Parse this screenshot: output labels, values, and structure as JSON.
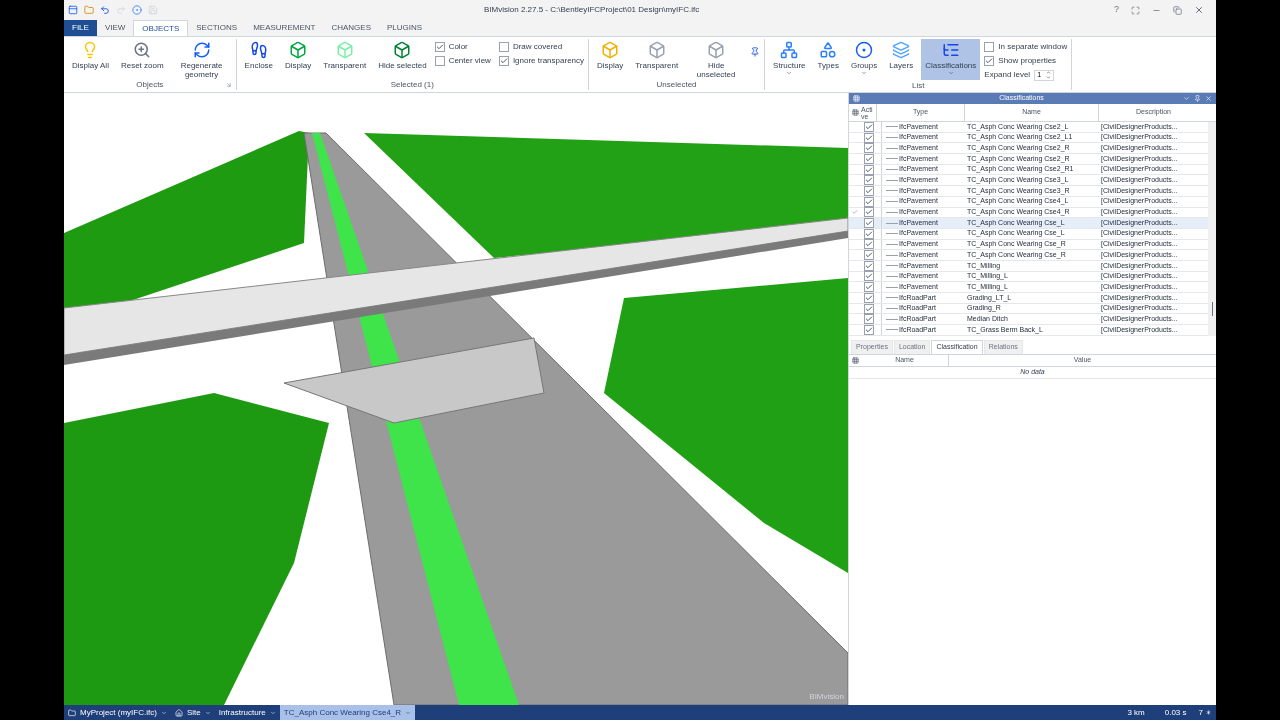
{
  "window": {
    "title": "BIMvision 2.27.5 - C:\\BentleyIFCProject\\01 Design\\myIFC.ifc",
    "help": "?"
  },
  "tabs": [
    {
      "label": "FILE",
      "kind": "file",
      "selected": false
    },
    {
      "label": "VIEW",
      "kind": "tab",
      "selected": false
    },
    {
      "label": "OBJECTS",
      "kind": "tab",
      "selected": true
    },
    {
      "label": "SECTIONS",
      "kind": "tab",
      "selected": false
    },
    {
      "label": "MEASUREMENT",
      "kind": "tab",
      "selected": false
    },
    {
      "label": "CHANGES",
      "kind": "tab",
      "selected": false
    },
    {
      "label": "PLUGINS",
      "kind": "tab",
      "selected": false
    }
  ],
  "ribbon": {
    "groups": [
      {
        "label": "Objects",
        "launcher": true,
        "buttons": [
          {
            "label": "Display All",
            "selected": false,
            "dropdown": false
          },
          {
            "label": "Reset zoom",
            "selected": false,
            "dropdown": false
          },
          {
            "label": "Regenerate geometry",
            "selected": false,
            "dropdown": false
          }
        ]
      },
      {
        "label": "Selected (1)",
        "launcher": false,
        "buttons": [
          {
            "label": "Enclose",
            "selected": false,
            "dropdown": false
          },
          {
            "label": "Display",
            "selected": false,
            "dropdown": false
          },
          {
            "label": "Transparent",
            "selected": false,
            "dropdown": false
          },
          {
            "label": "Hide selected",
            "selected": false,
            "dropdown": false
          }
        ],
        "options": [
          {
            "label": "Color",
            "checked": true
          },
          {
            "label": "Center view",
            "checked": false
          },
          {
            "label": "Draw covered",
            "checked": false
          },
          {
            "label": "Ignore transparency",
            "checked": true
          }
        ]
      },
      {
        "label": "Unselected",
        "launcher": false,
        "buttons": [
          {
            "label": "Display",
            "selected": false,
            "dropdown": false
          },
          {
            "label": "Transparent",
            "selected": false,
            "dropdown": false
          },
          {
            "label": "Hide unselected",
            "selected": false,
            "dropdown": false
          }
        ]
      },
      {
        "label": "List",
        "launcher": false,
        "buttons": [
          {
            "label": "Structure",
            "selected": false,
            "dropdown": true
          },
          {
            "label": "Types",
            "selected": false,
            "dropdown": false
          },
          {
            "label": "Groups",
            "selected": false,
            "dropdown": true
          },
          {
            "label": "Layers",
            "selected": false,
            "dropdown": false
          },
          {
            "label": "Classifications",
            "selected": true,
            "dropdown": true
          }
        ],
        "options": [
          {
            "label": "In separate window",
            "checked": false
          },
          {
            "label": "Show properties",
            "checked": true
          }
        ],
        "spinner": {
          "label": "Expand level",
          "value": "1"
        }
      }
    ]
  },
  "viewport": {
    "logo": "BIMvision"
  },
  "classifications": {
    "title": "Classifications",
    "columns": [
      "Active",
      "Type",
      "Name",
      "Description"
    ],
    "rows": [
      {
        "marked": false,
        "active": true,
        "selected": false,
        "type": "IfcPavement",
        "name": "TC_Asph Conc Wearing Cse2_L",
        "description": "[CivilDesignerProducts..."
      },
      {
        "marked": false,
        "active": true,
        "selected": false,
        "type": "IfcPavement",
        "name": "TC_Asph Conc Wearing Cse2_L1",
        "description": "[CivilDesignerProducts..."
      },
      {
        "marked": false,
        "active": true,
        "selected": false,
        "type": "IfcPavement",
        "name": "TC_Asph Conc Wearing Cse2_R",
        "description": "[CivilDesignerProducts..."
      },
      {
        "marked": false,
        "active": true,
        "selected": false,
        "type": "IfcPavement",
        "name": "TC_Asph Conc Wearing Cse2_R",
        "description": "[CivilDesignerProducts..."
      },
      {
        "marked": false,
        "active": true,
        "selected": false,
        "type": "IfcPavement",
        "name": "TC_Asph Conc Wearing Cse2_R1",
        "description": "[CivilDesignerProducts..."
      },
      {
        "marked": false,
        "active": true,
        "selected": false,
        "type": "IfcPavement",
        "name": "TC_Asph Conc Wearing Cse3_L",
        "description": "[CivilDesignerProducts..."
      },
      {
        "marked": false,
        "active": true,
        "selected": false,
        "type": "IfcPavement",
        "name": "TC_Asph Conc Wearing Cse3_R",
        "description": "[CivilDesignerProducts..."
      },
      {
        "marked": false,
        "active": true,
        "selected": false,
        "type": "IfcPavement",
        "name": "TC_Asph Conc Wearing Cse4_L",
        "description": "[CivilDesignerProducts..."
      },
      {
        "marked": true,
        "active": true,
        "selected": false,
        "type": "IfcPavement",
        "name": "TC_Asph Conc Wearing Cse4_R",
        "description": "[CivilDesignerProducts..."
      },
      {
        "marked": false,
        "active": true,
        "selected": true,
        "type": "IfcPavement",
        "name": "TC_Asph Conc Wearing Cse_L",
        "description": "[CivilDesignerProducts..."
      },
      {
        "marked": false,
        "active": true,
        "selected": false,
        "type": "IfcPavement",
        "name": "TC_Asph Conc Wearing Cse_L",
        "description": "[CivilDesignerProducts..."
      },
      {
        "marked": false,
        "active": true,
        "selected": false,
        "type": "IfcPavement",
        "name": "TC_Asph Conc Wearing Cse_R",
        "description": "[CivilDesignerProducts..."
      },
      {
        "marked": false,
        "active": true,
        "selected": false,
        "type": "IfcPavement",
        "name": "TC_Asph Conc Wearing Cse_R",
        "description": "[CivilDesignerProducts..."
      },
      {
        "marked": false,
        "active": true,
        "selected": false,
        "type": "IfcPavement",
        "name": "TC_Milling",
        "description": "[CivilDesignerProducts..."
      },
      {
        "marked": false,
        "active": true,
        "selected": false,
        "type": "IfcPavement",
        "name": "TC_Milling_L",
        "description": "[CivilDesignerProducts..."
      },
      {
        "marked": false,
        "active": true,
        "selected": false,
        "type": "IfcPavement",
        "name": "TC_Milling_L",
        "description": "[CivilDesignerProducts..."
      },
      {
        "marked": false,
        "active": true,
        "selected": false,
        "type": "IfcRoadPart",
        "name": "Grading_LT_L",
        "description": "[CivilDesignerProducts..."
      },
      {
        "marked": false,
        "active": true,
        "selected": false,
        "type": "IfcRoadPart",
        "name": "Grading_R",
        "description": "[CivilDesignerProducts..."
      },
      {
        "marked": false,
        "active": true,
        "selected": false,
        "type": "IfcRoadPart",
        "name": "Median Ditch",
        "description": "[CivilDesignerProducts..."
      },
      {
        "marked": false,
        "active": true,
        "selected": false,
        "type": "IfcRoadPart",
        "name": "TC_Grass Berm Back_L",
        "description": "[CivilDesignerProducts..."
      }
    ]
  },
  "properties": {
    "tabs": [
      {
        "label": "Properties",
        "selected": false
      },
      {
        "label": "Location",
        "selected": false
      },
      {
        "label": "Classification",
        "selected": true
      },
      {
        "label": "Relations",
        "selected": false
      }
    ],
    "columns": [
      "Name",
      "Value"
    ],
    "empty_text": "No data"
  },
  "status_bar": {
    "breadcrumbs": [
      {
        "label": "MyProject (myIFC.ifc)",
        "selected": false
      },
      {
        "label": "Site",
        "selected": false
      },
      {
        "label": "Infrastructure",
        "selected": false
      },
      {
        "label": "TC_Asph Conc Wearing Cse4_R",
        "selected": true
      }
    ],
    "scale": "3 km",
    "time": "0.03 s",
    "count": "7"
  }
}
